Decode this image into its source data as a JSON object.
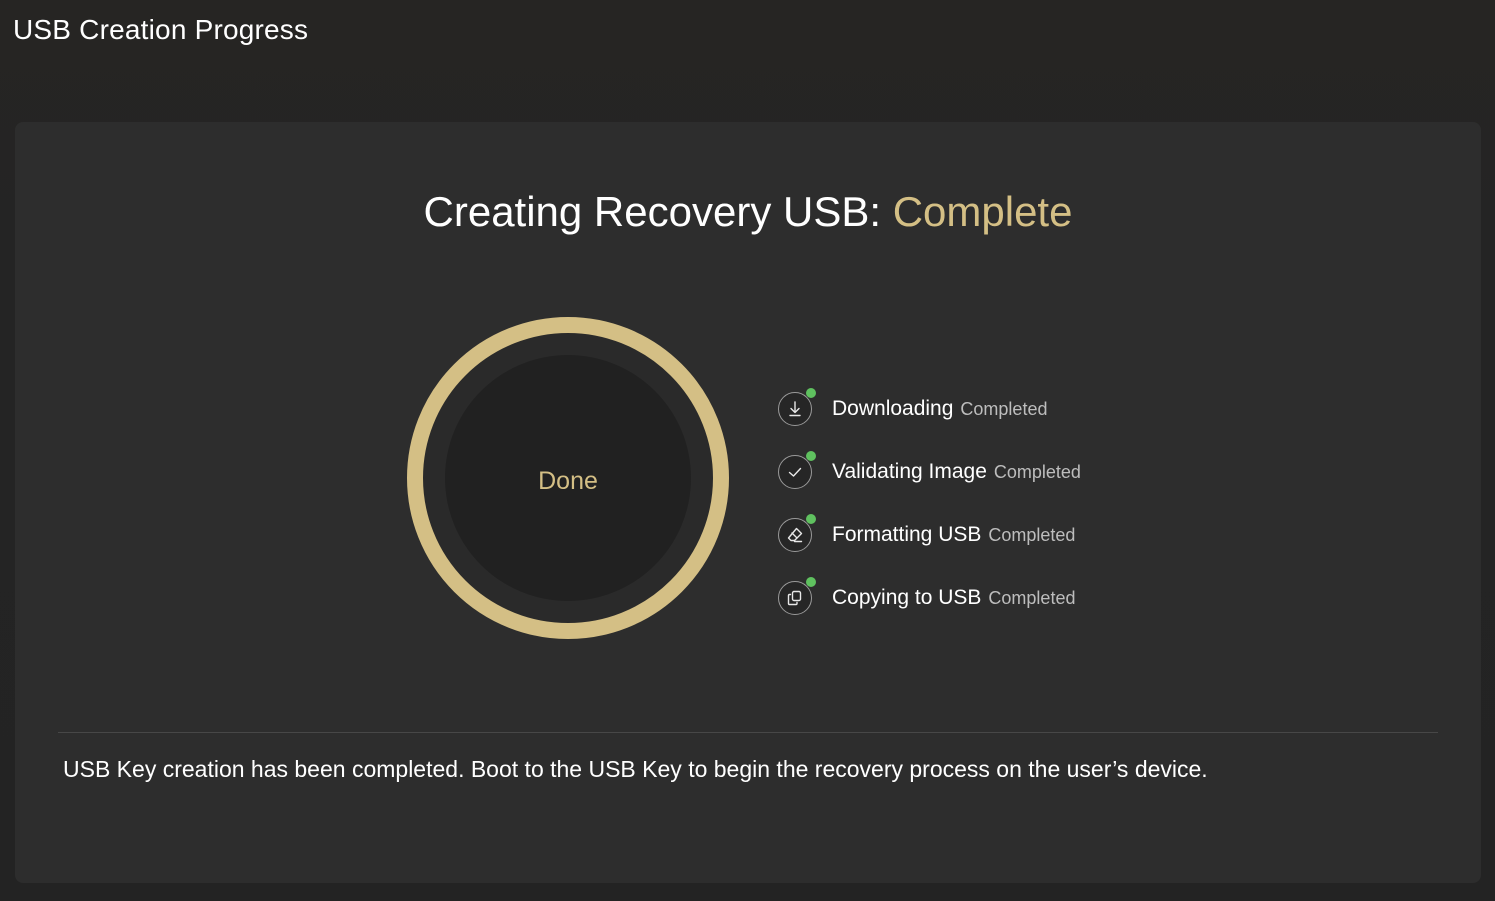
{
  "window": {
    "title": "USB Creation Progress"
  },
  "headline": {
    "prefix": "Creating Recovery USB:",
    "status": "Complete"
  },
  "progress": {
    "label": "Done",
    "fraction": 1.0
  },
  "steps": [
    {
      "name": "Downloading",
      "status": "Completed",
      "icon": "download-icon"
    },
    {
      "name": "Validating Image",
      "status": "Completed",
      "icon": "checkmark-icon"
    },
    {
      "name": "Formatting USB",
      "status": "Completed",
      "icon": "eraser-icon"
    },
    {
      "name": "Copying to USB",
      "status": "Completed",
      "icon": "copy-icon"
    }
  ],
  "message": "USB Key creation has been completed. Boot to the USB Key to begin the recovery process on the user’s device.",
  "colors": {
    "accent": "#d4bf85",
    "success": "#5fc15f",
    "card": "#2d2d2d",
    "background": "#242424"
  }
}
